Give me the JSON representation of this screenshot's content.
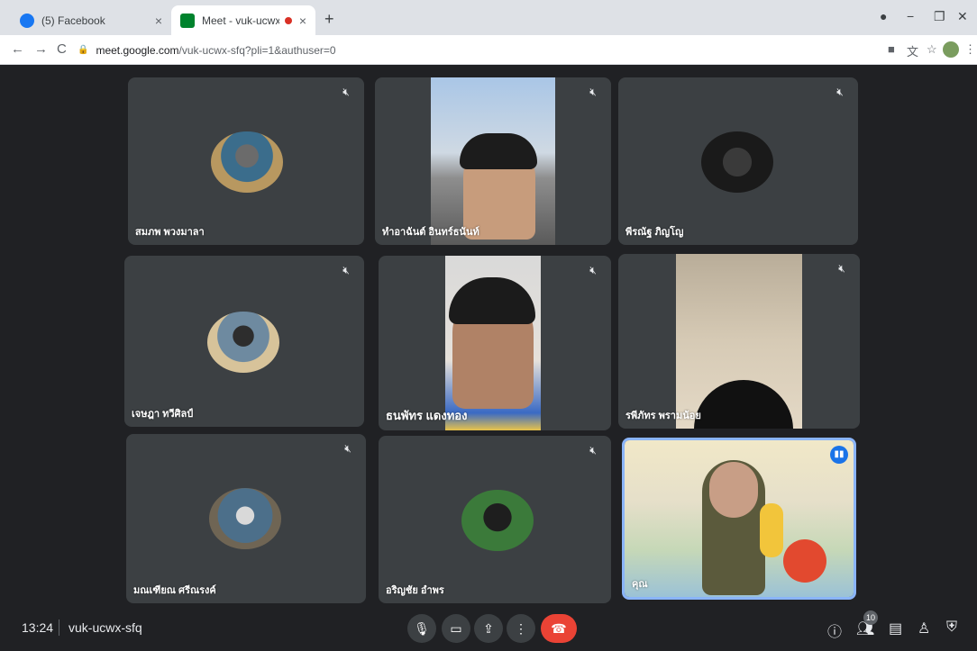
{
  "browser": {
    "tabs": [
      {
        "title": "(5) Facebook",
        "close": "×"
      },
      {
        "title": "Meet - vuk-ucwx-sfq",
        "close": "×"
      }
    ],
    "new_tab": "+",
    "window_controls": {
      "minimize": "−",
      "restore": "❐",
      "close": "✕"
    },
    "nav": {
      "back": "←",
      "forward": "→",
      "reload": "C"
    },
    "url_host": "meet.google.com",
    "url_path": "/vuk-ucwx-sfq?pli=1&authuser=0"
  },
  "participants": [
    {
      "name": "สมภพ พวงมาลา",
      "muted": true
    },
    {
      "name": "ทำอาฉันต์ อินทร์ธนันท์",
      "muted": true
    },
    {
      "name": "พีรณัฐ ภิญโญ",
      "muted": true
    },
    {
      "name": "เจษฎา ทวีศิลป์",
      "muted": true
    },
    {
      "name": "ธนพัทร แดงทอง",
      "muted": true
    },
    {
      "name": "รพีภัทร พรามน้อย",
      "muted": true
    },
    {
      "name": "มณเฑียณ ศรีณรงค์",
      "muted": true
    },
    {
      "name": "อริญชัย อำพร",
      "muted": true
    },
    {
      "name": "คุณ",
      "muted": false,
      "speaking": true
    }
  ],
  "bottom_bar": {
    "time": "13:24",
    "meeting_code": "vuk-ucwx-sfq",
    "participant_count": "10"
  },
  "colors": {
    "meet_bg": "#202124",
    "tile_bg": "#3c4043",
    "end_call": "#ea4335",
    "self_border": "#8ab4f8",
    "facebook_blue": "#1877f2"
  }
}
